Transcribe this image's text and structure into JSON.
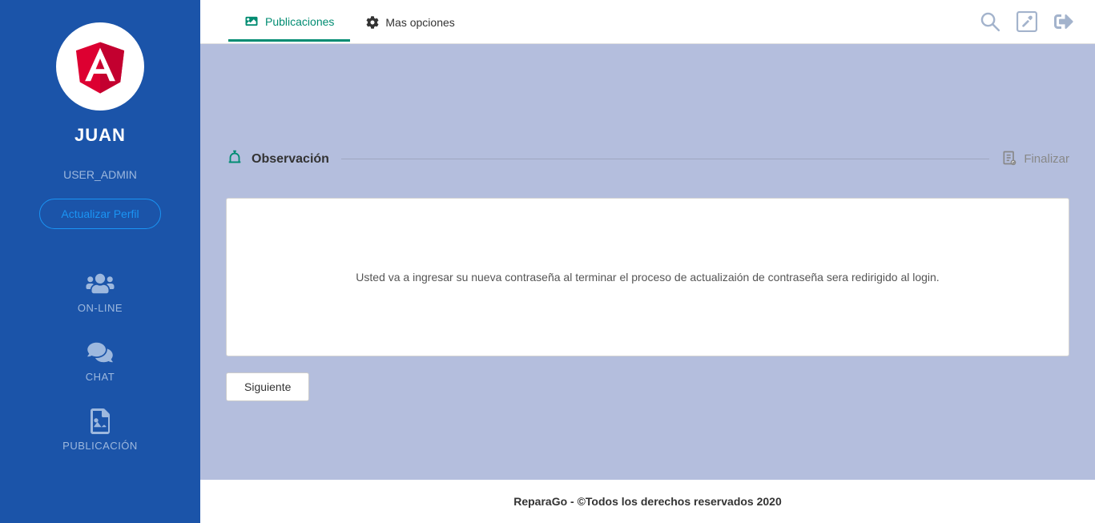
{
  "sidebar": {
    "user_name": "JUAN",
    "user_role": "USER_ADMIN",
    "update_profile_label": "Actualizar Perfil",
    "nav": [
      {
        "label": "ON-LINE"
      },
      {
        "label": "CHAT"
      },
      {
        "label": "PUBLICACIÓN"
      }
    ]
  },
  "topbar": {
    "tabs": [
      {
        "label": "Publicaciones"
      },
      {
        "label": "Mas opciones"
      }
    ]
  },
  "section": {
    "title": "Observación",
    "finalize_label": "Finalizar"
  },
  "observation": {
    "text": "Usted va a ingresar su nueva contraseña al terminar el proceso de actualizaión de contraseña sera redirigido al login."
  },
  "buttons": {
    "next": "Siguiente"
  },
  "footer": {
    "text": "ReparaGo - ©Todos los derechos reservados 2020"
  }
}
